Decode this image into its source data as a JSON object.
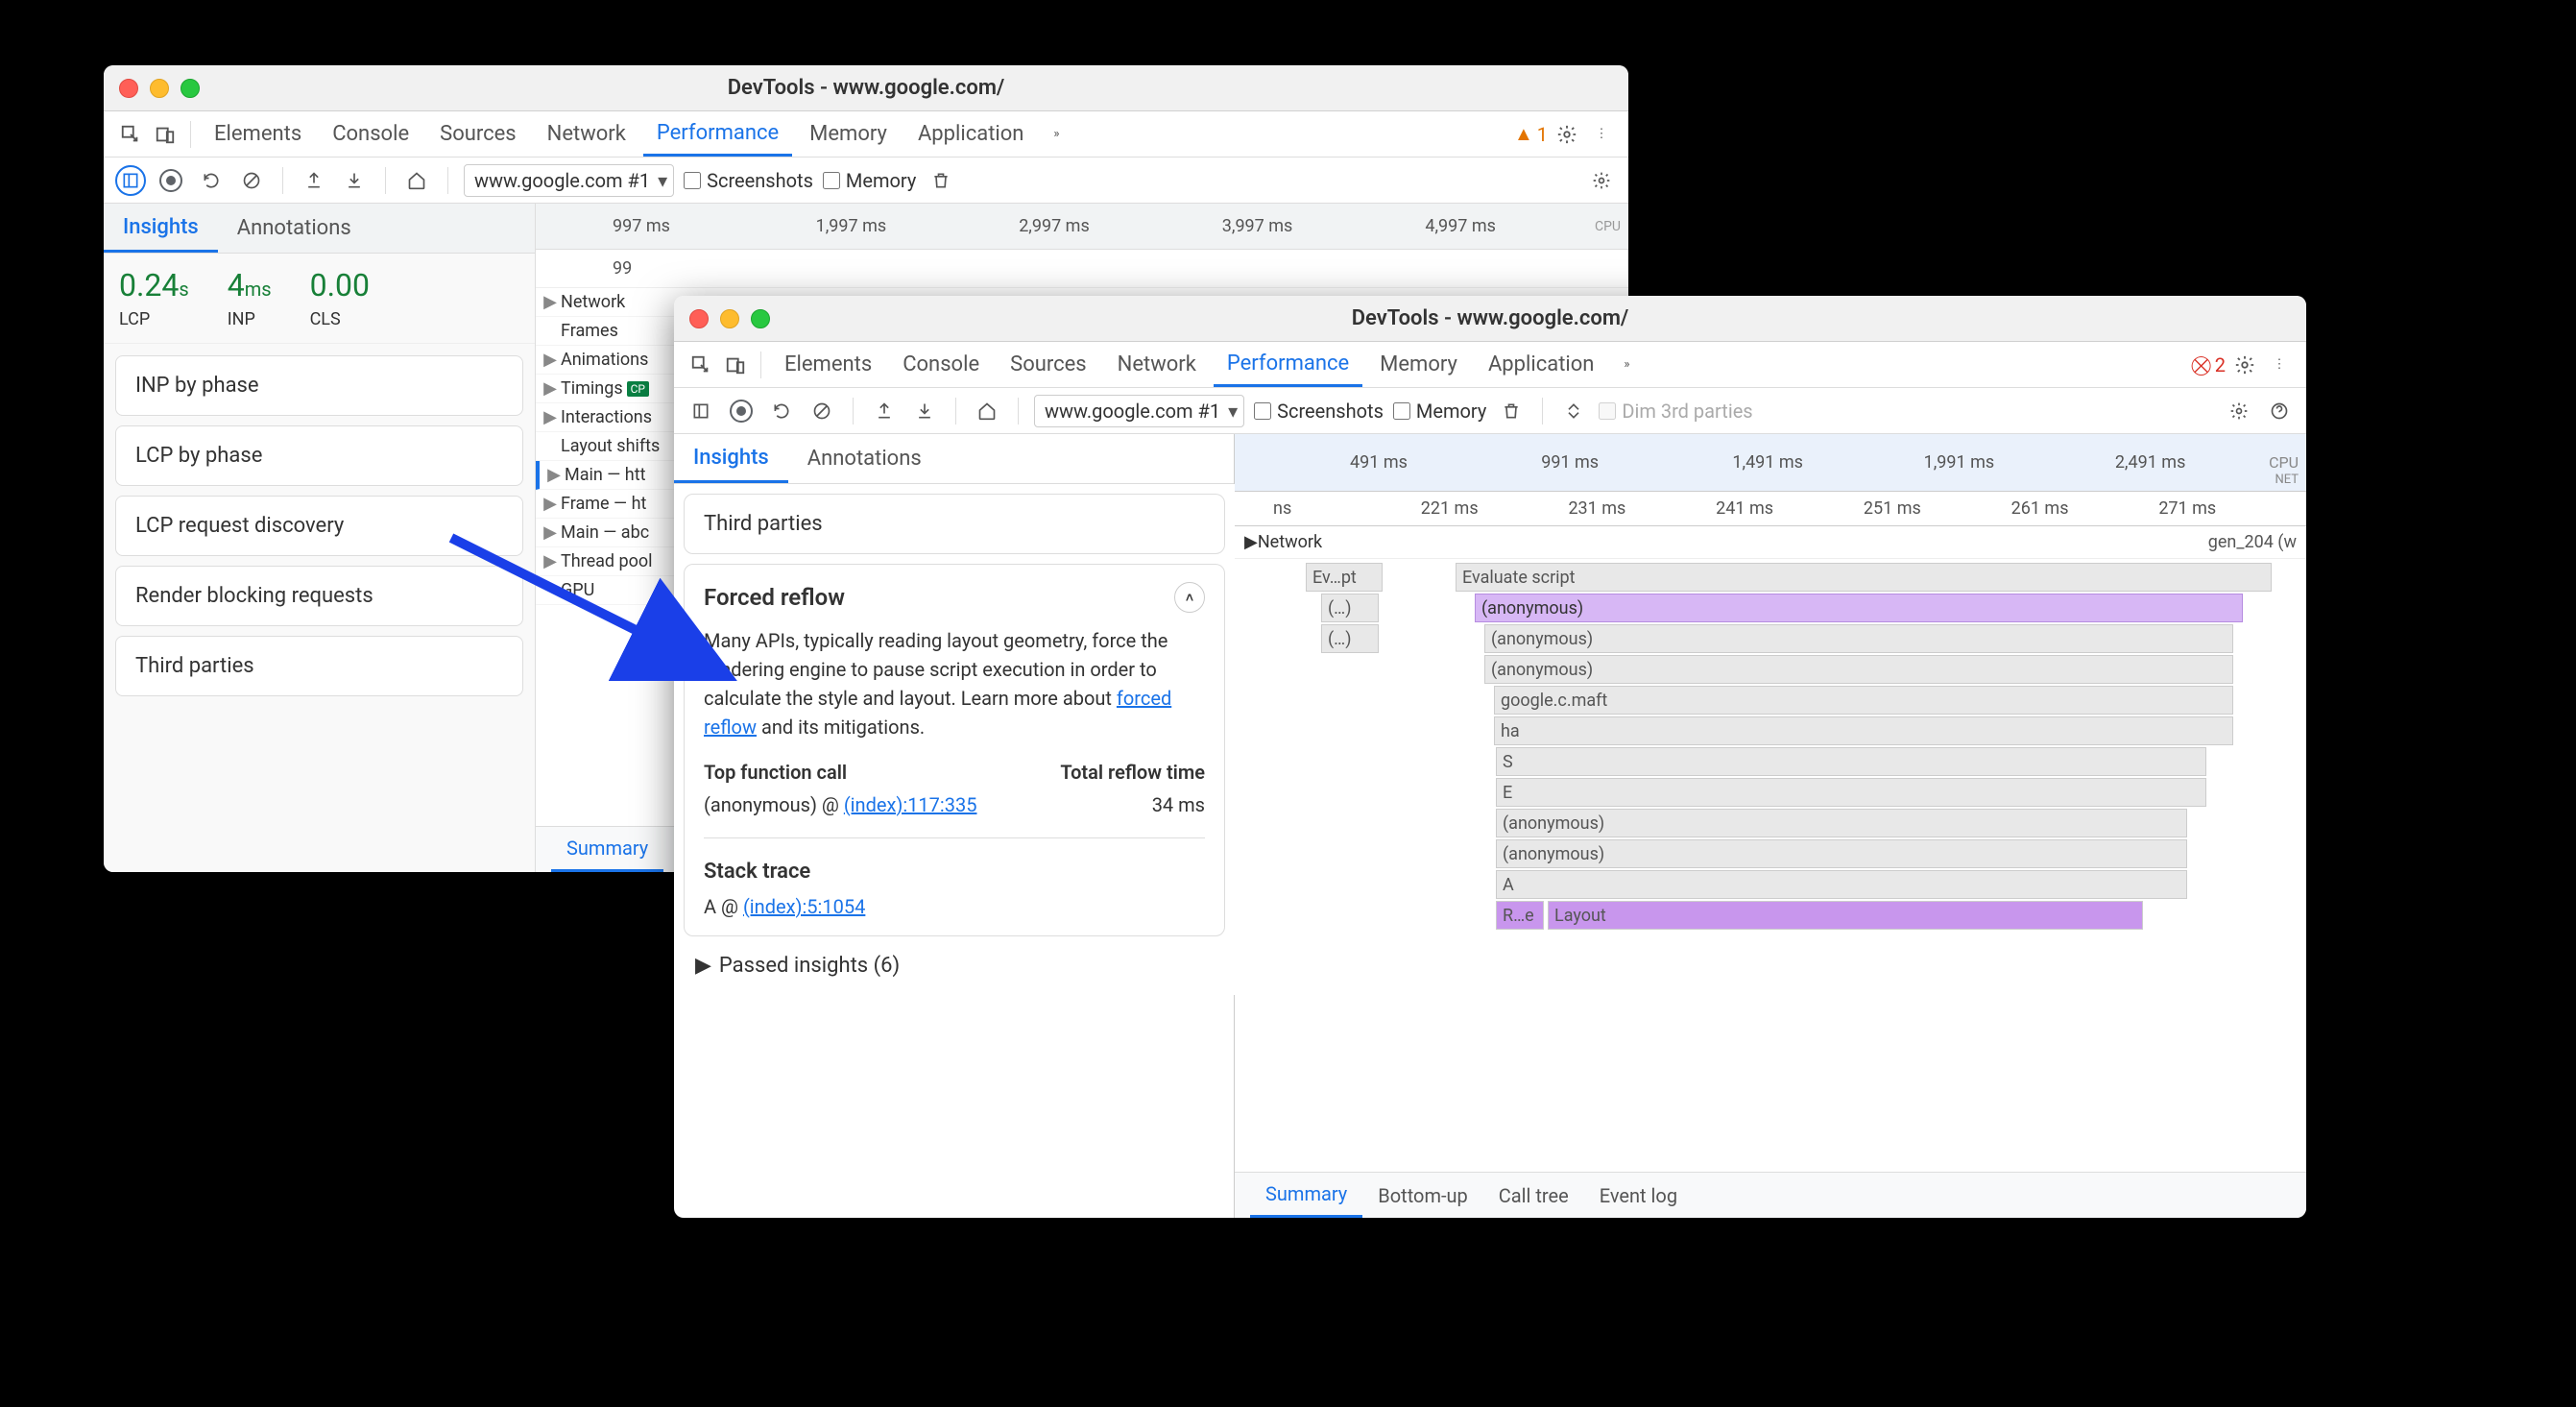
{
  "window_back": {
    "title": "DevTools - www.google.com/",
    "tabs": [
      "Elements",
      "Console",
      "Sources",
      "Network",
      "Performance",
      "Memory",
      "Application"
    ],
    "active_tab": "Performance",
    "warning_count": "1",
    "dropdown": "www.google.com #1",
    "checkbox_screenshots": "Screenshots",
    "checkbox_memory": "Memory",
    "ruler": [
      "997 ms",
      "1,997 ms",
      "2,997 ms",
      "3,997 ms",
      "4,997 ms"
    ],
    "ruler_suffix": "CPU",
    "side_tabs": {
      "insights": "Insights",
      "annotations": "Annotations"
    },
    "metrics": [
      {
        "value": "0.24",
        "unit": "s",
        "label": "LCP"
      },
      {
        "value": "4",
        "unit": "ms",
        "label": "INP"
      },
      {
        "value": "0.00",
        "unit": "",
        "label": "CLS"
      }
    ],
    "insight_cards": [
      "INP by phase",
      "LCP by phase",
      "LCP request discovery",
      "Render blocking requests",
      "Third parties"
    ],
    "tracks": [
      "Network",
      "Frames",
      "Animations",
      "Timings",
      "Interactions",
      "Layout shifts",
      "Main — htt",
      "Frame — ht",
      "Main — abc",
      "Thread pool",
      "GPU"
    ],
    "timings_badge": "CP",
    "summary_tab": "Summary"
  },
  "window_front": {
    "title": "DevTools - www.google.com/",
    "tabs": [
      "Elements",
      "Console",
      "Sources",
      "Network",
      "Performance",
      "Memory",
      "Application"
    ],
    "active_tab": "Performance",
    "error_count": "2",
    "dropdown": "www.google.com #1",
    "checkbox_screenshots": "Screenshots",
    "checkbox_memory": "Memory",
    "dim_label": "Dim 3rd parties",
    "minimap_ruler": [
      "491 ms",
      "991 ms",
      "1,491 ms",
      "1,991 ms",
      "2,491 ms"
    ],
    "cpu_label": "CPU",
    "net_label": "NET",
    "side_tabs": {
      "insights": "Insights",
      "annotations": "Annotations"
    },
    "third_parties_card": "Third parties",
    "forced_reflow": {
      "title": "Forced reflow",
      "description_pre": "Many APIs, typically reading layout geometry, force the rendering engine to pause script execution in order to calculate the style and layout. Learn more about ",
      "link_text": "forced reflow",
      "description_post": " and its mitigations.",
      "top_fn_header": "Top function call",
      "total_time_header": "Total reflow time",
      "top_fn": "(anonymous) @ ",
      "top_fn_link": "(index):117:335",
      "total_time": "34 ms",
      "stack_trace_header": "Stack trace",
      "stack_entry": "A @ ",
      "stack_link": "(index):5:1054"
    },
    "passed_insights": "Passed insights (6)",
    "flame_ruler": [
      "ns",
      "221 ms",
      "231 ms",
      "241 ms",
      "251 ms",
      "261 ms",
      "271 ms"
    ],
    "network_label": "Network",
    "gen_204": "gen_204 (w",
    "flame_bars": {
      "evscript": "Ev…pt",
      "evaluate": "Evaluate script",
      "ellipsis": "(…)",
      "anon": "(anonymous)",
      "maft": "google.c.maft",
      "ha": "ha",
      "S": "S",
      "E": "E",
      "A": "A",
      "re": "R…e",
      "layout": "Layout"
    },
    "bottom_tabs": [
      "Summary",
      "Bottom-up",
      "Call tree",
      "Event log"
    ]
  }
}
